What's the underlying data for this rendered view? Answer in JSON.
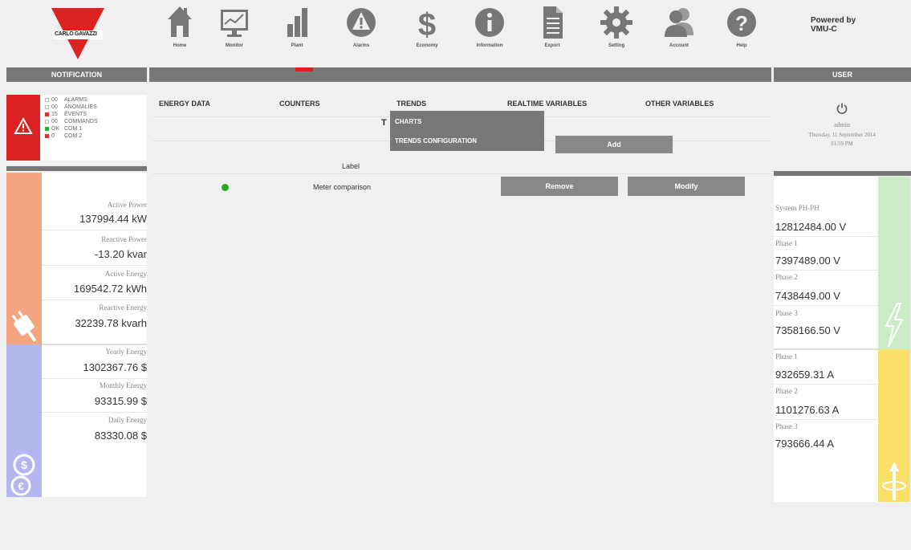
{
  "header": {
    "logo_text": "CARLO GAVAZZI",
    "nav": [
      "Home",
      "Monitor",
      "Plant",
      "Alarms",
      "Economy",
      "Information",
      "Export",
      "Setting",
      "Account",
      "Help"
    ],
    "powered_line1": "Powered by",
    "powered_line2": "VMU-C"
  },
  "bars": {
    "notification": "NOTIFICATION",
    "user": "USER"
  },
  "notifications": [
    {
      "state": "empty",
      "count": "00",
      "label": "ALARMS"
    },
    {
      "state": "empty",
      "count": "00",
      "label": "ANOMALIES"
    },
    {
      "state": "red",
      "count": "15",
      "label": "EVENTS"
    },
    {
      "state": "empty",
      "count": "00",
      "label": "COMMANDS"
    },
    {
      "state": "green",
      "count": "OK",
      "label": "COM 1"
    },
    {
      "state": "red",
      "count": "0",
      "label": "COM 2"
    }
  ],
  "tabs": [
    "ENERGY DATA",
    "COUNTERS",
    "TRENDS",
    "REALTIME VARIABLES",
    "OTHER VARIABLES"
  ],
  "trends_dropdown": [
    "CHARTS",
    "TRENDS CONFIGURATION"
  ],
  "trends_partial_letter": "T",
  "add_label": "Add",
  "table": {
    "label_header": "Label",
    "row_name": "Meter comparison",
    "remove_label": "Remove",
    "modify_label": "Modify"
  },
  "left_power": [
    {
      "label": "Active Power",
      "value": "137994.44 kW"
    },
    {
      "label": "Reactive Power",
      "value": "-13.20 kvar"
    },
    {
      "label": "Active Energy",
      "value": "169542.72 kWh"
    },
    {
      "label": "Reactive Energy",
      "value": "32239.78 kvarh"
    }
  ],
  "left_economy": [
    {
      "label": "Yearly Energy",
      "value": "1302367.76 $"
    },
    {
      "label": "Monthly Energy",
      "value": "93315.99 $"
    },
    {
      "label": "Daily Energy",
      "value": "83330.08 $"
    }
  ],
  "user": {
    "name": "admin",
    "date": "Thursday, 11 September 2014",
    "time": "01:59 PM"
  },
  "right_voltage": [
    {
      "label": "System PH-PH",
      "value": "12812484.00 V"
    },
    {
      "label": "Phase 1",
      "value": "7397489.00 V"
    },
    {
      "label": "Phase 2",
      "value": "7438449.00 V"
    },
    {
      "label": "Phase 3",
      "value": "7358166.50 V"
    }
  ],
  "right_current": [
    {
      "label": "Phase 1",
      "value": "932659.31 A"
    },
    {
      "label": "Phase 2",
      "value": "1101276.63 A"
    },
    {
      "label": "Phase 3",
      "value": "793666.44 A"
    }
  ],
  "colors": {
    "brand_red": "#d22222",
    "bar_gray": "#777777",
    "power_orange": "#f5a480",
    "economy_purple": "#b4b6ee",
    "voltage_green": "#c9ecc4",
    "current_yellow": "#f8e06a",
    "status_green": "#22aa22"
  }
}
